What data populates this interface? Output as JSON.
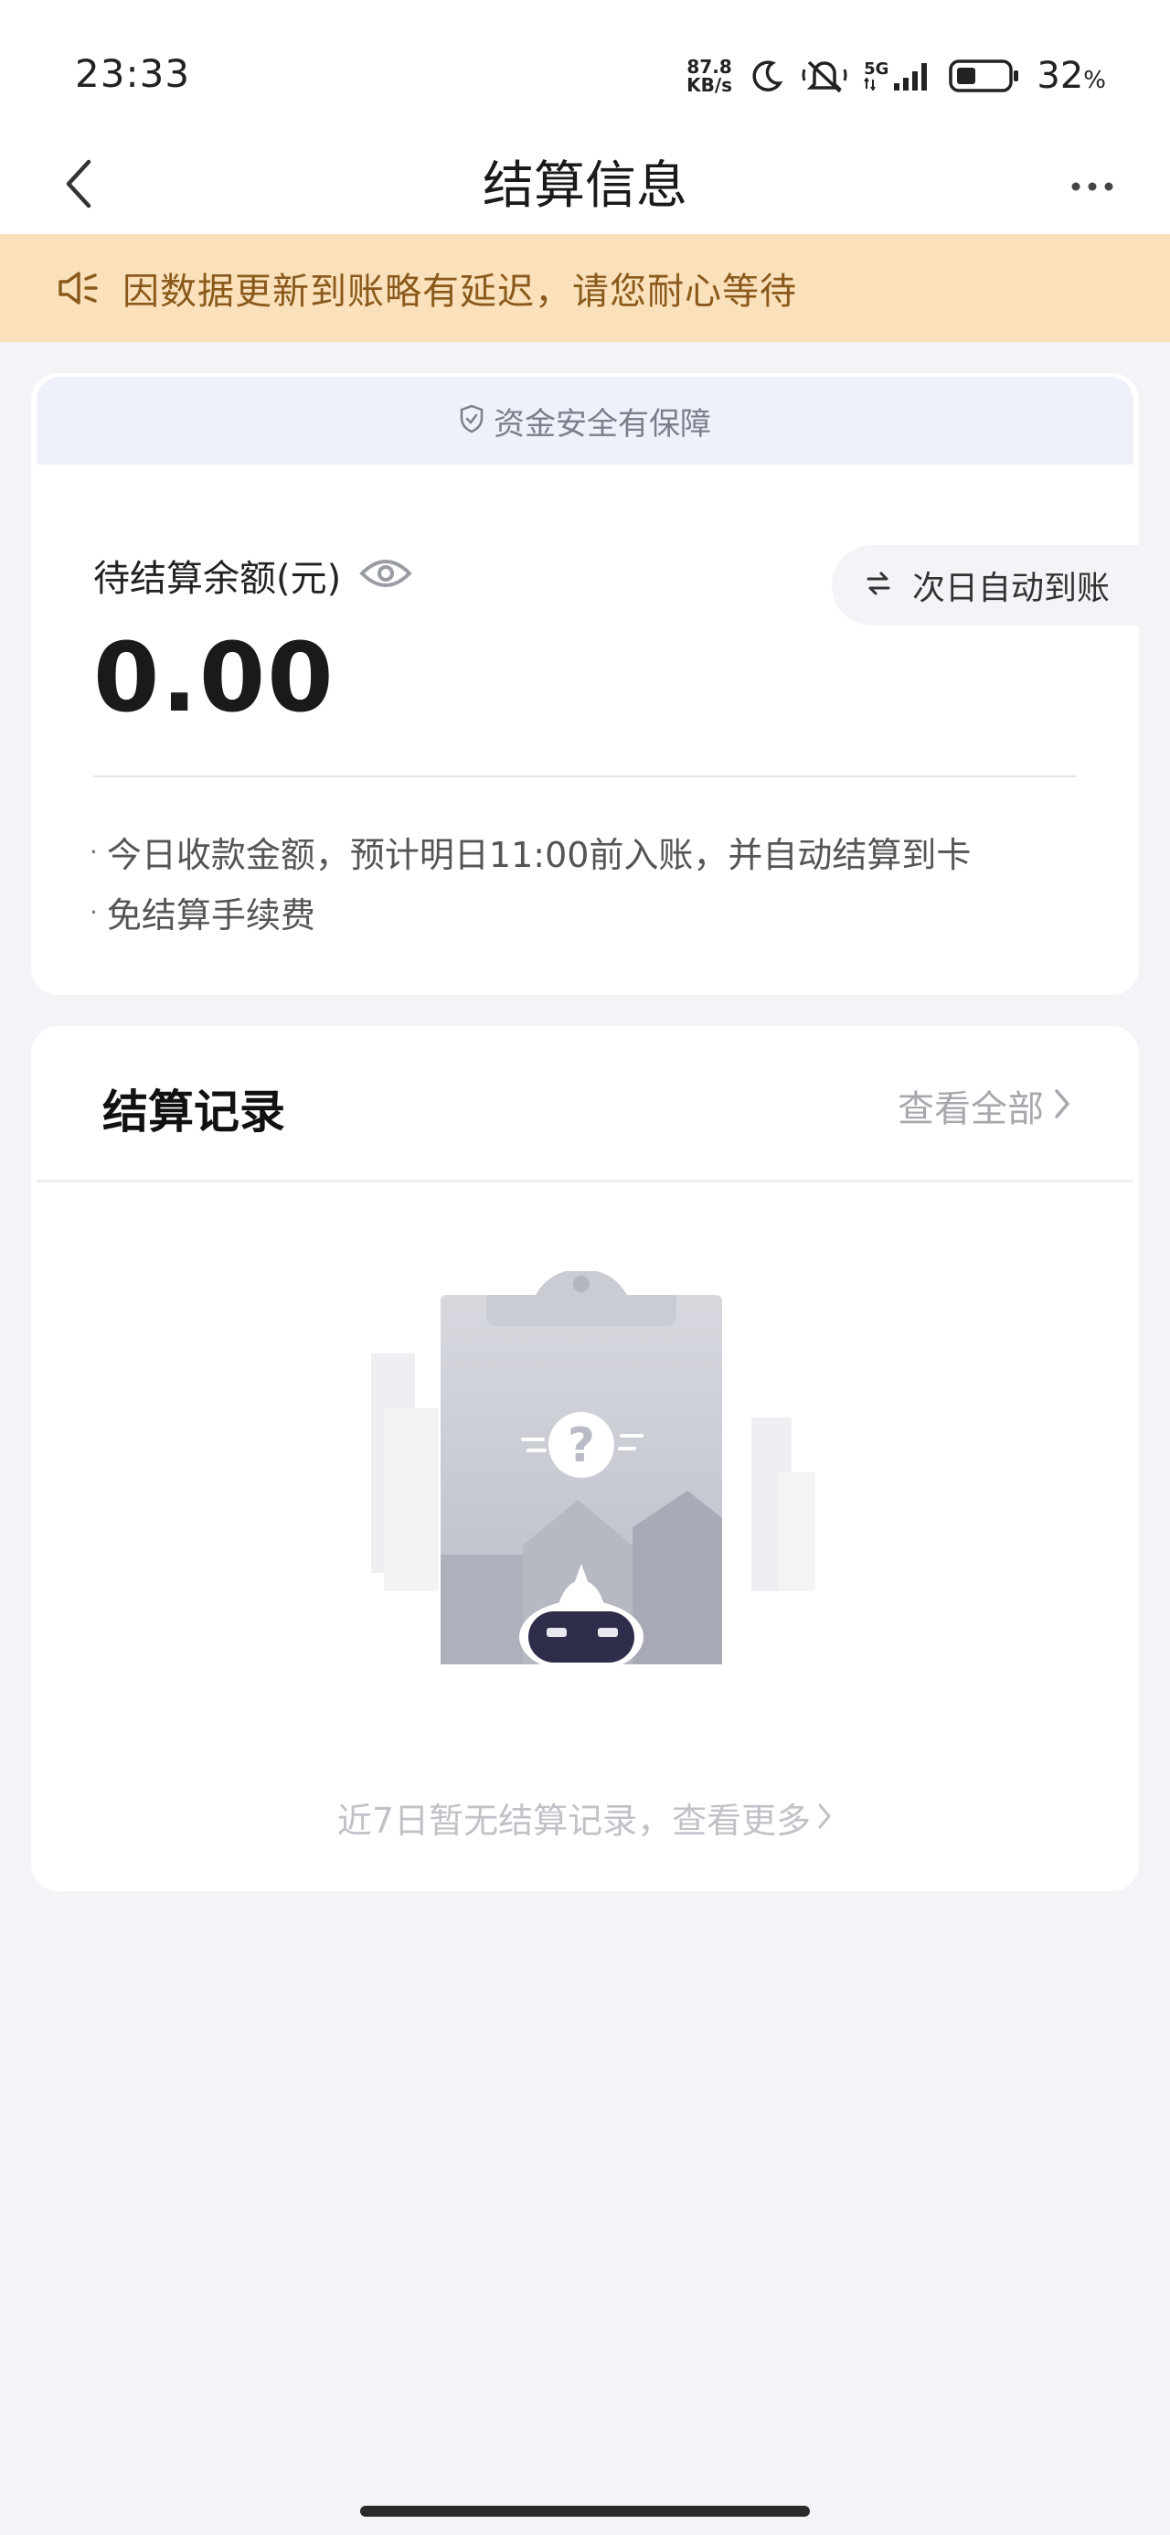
{
  "status_bar": {
    "time": "23:33",
    "net_speed_value": "87.8",
    "net_speed_unit": "KB/s",
    "signal_label": "5G",
    "battery_percent": "32",
    "battery_unit": "%"
  },
  "header": {
    "title": "结算信息"
  },
  "notice": {
    "text": "因数据更新到账略有延迟，请您耐心等待"
  },
  "balance": {
    "safety_text": "资金安全有保障",
    "label": "待结算余额(元)",
    "amount": "0.00",
    "auto_settle_label": "次日自动到账",
    "notes": [
      "今日收款金额，预计明日11:00前入账，并自动结算到卡",
      "免结算手续费"
    ]
  },
  "records": {
    "title": "结算记录",
    "view_all_label": "查看全部",
    "empty_text": "近7日暂无结算记录，查看更多"
  },
  "colors": {
    "notice_bg": "#fbe1bb",
    "notice_text": "#8a5a1c",
    "page_bg": "#f3f4f8",
    "safety_bg": "#eef0fa"
  }
}
